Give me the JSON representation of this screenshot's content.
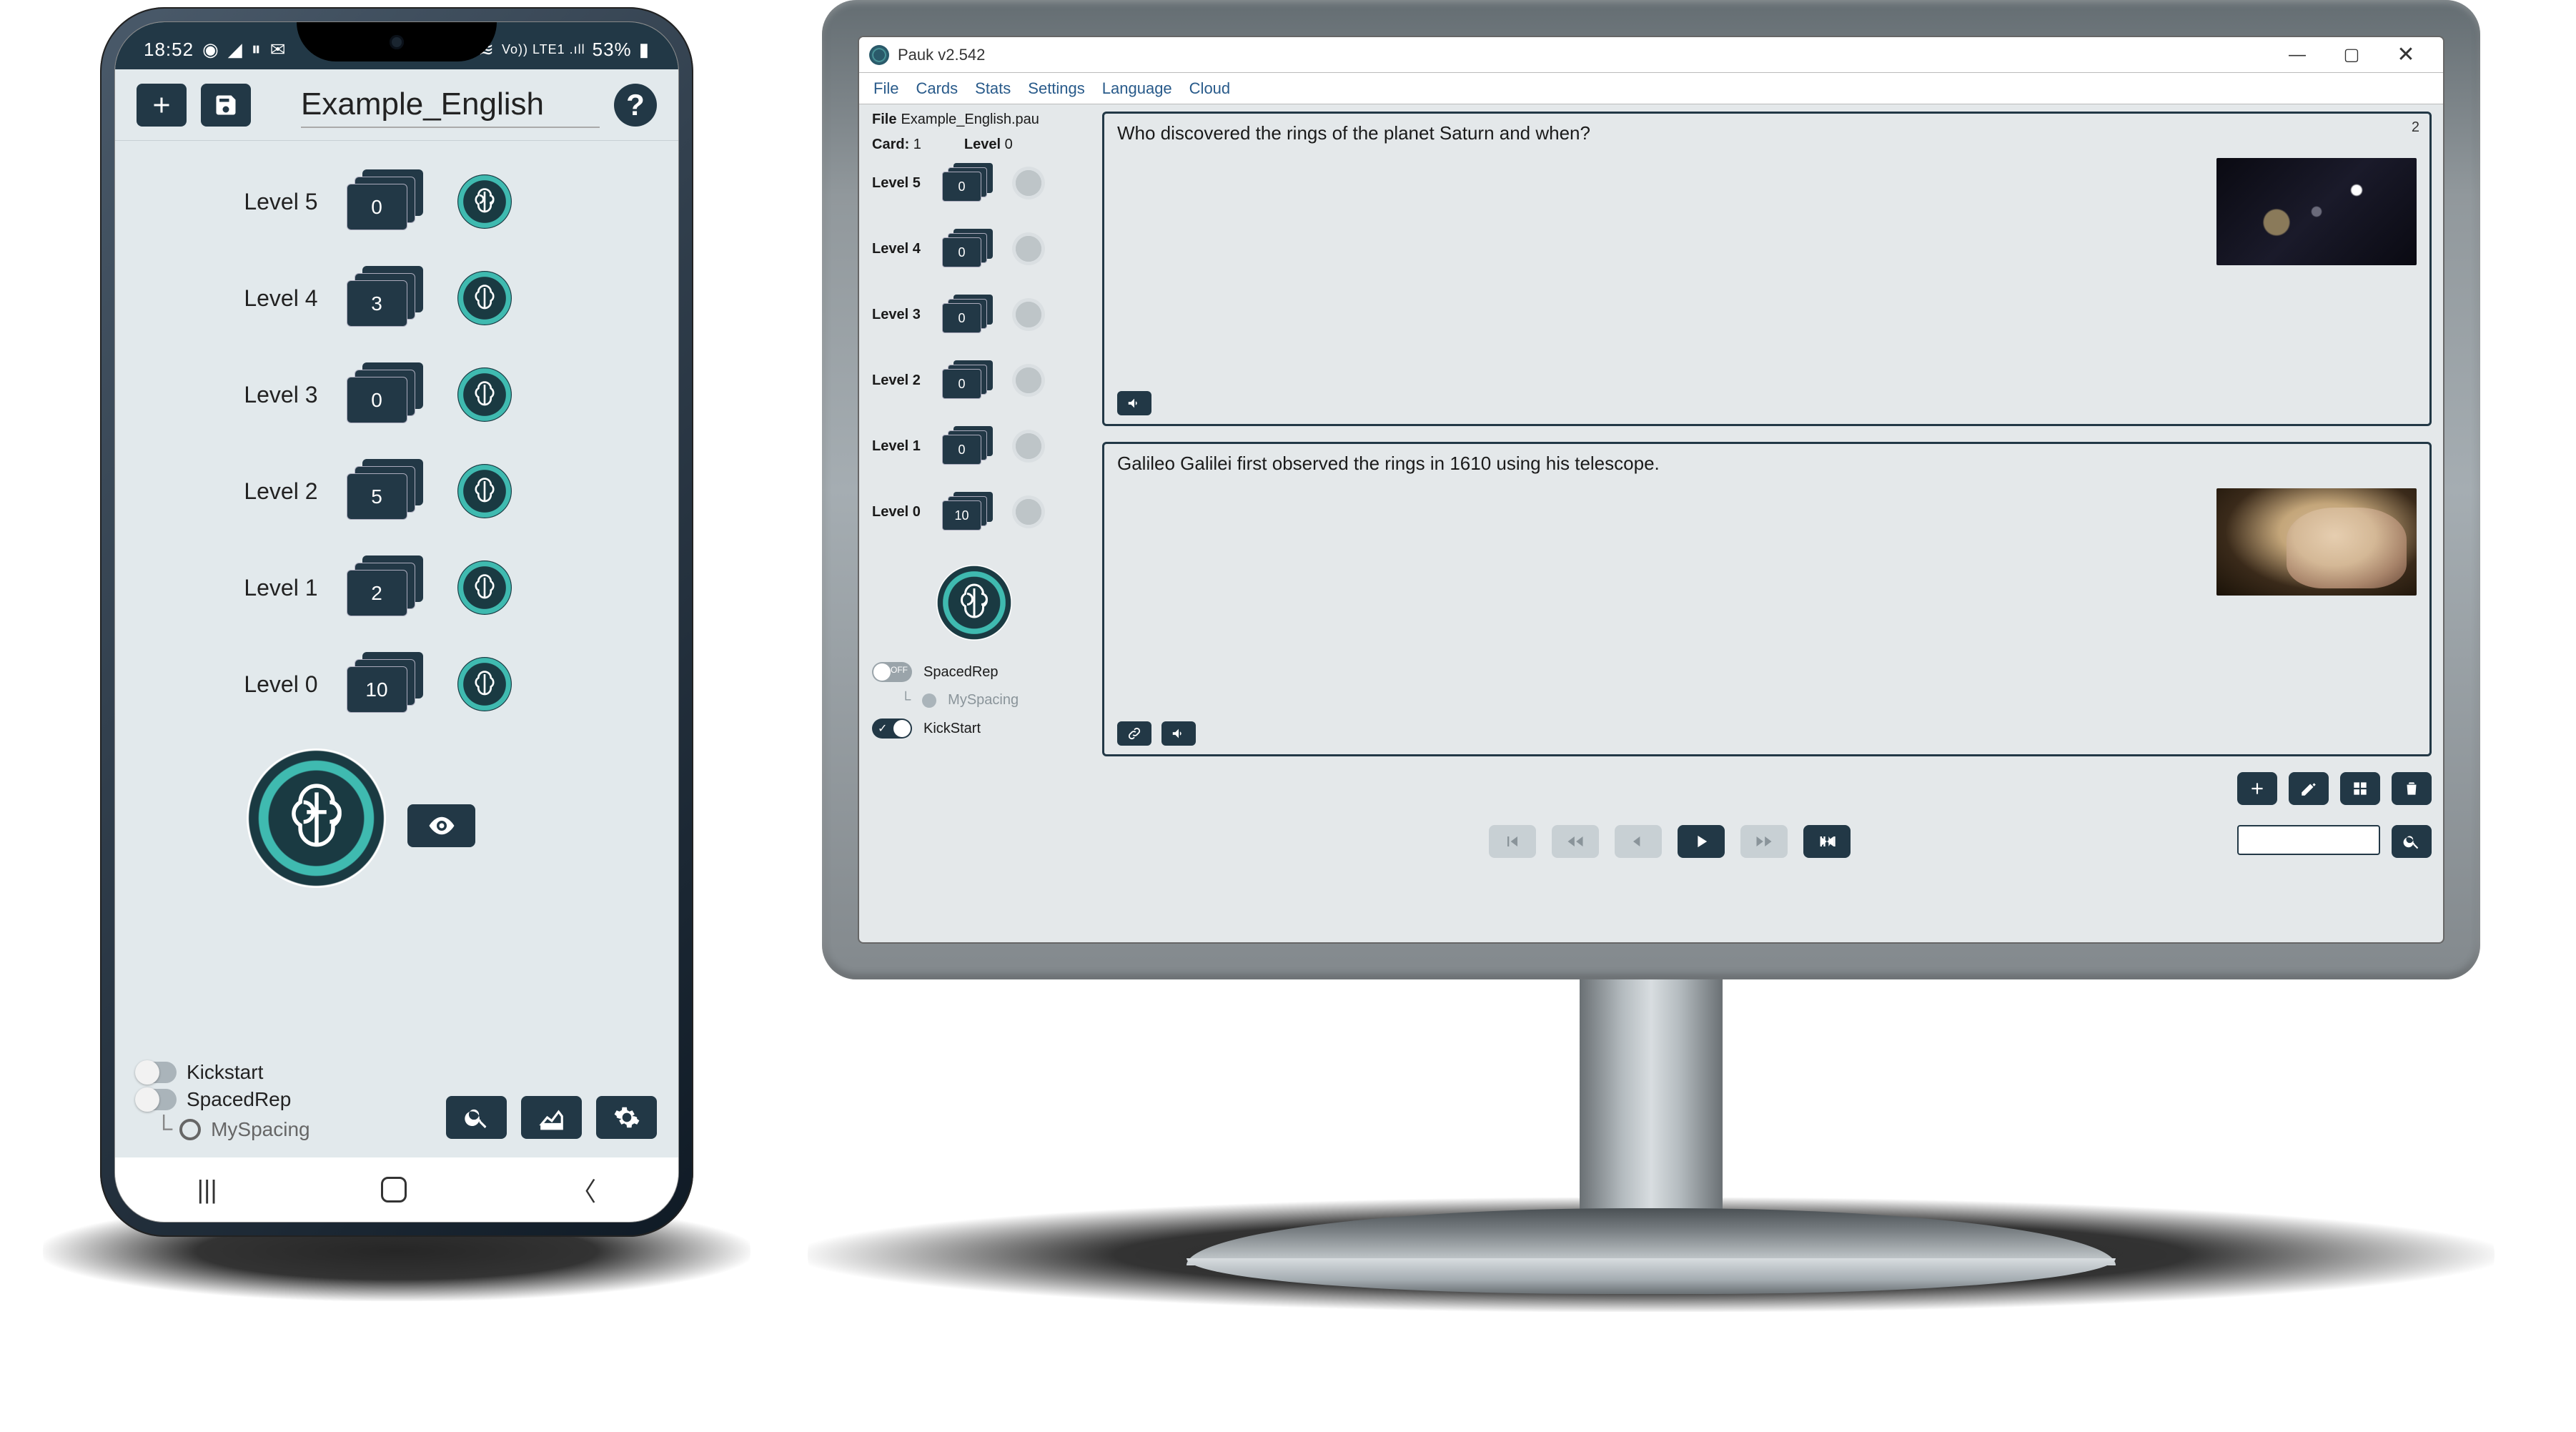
{
  "phone": {
    "status": {
      "time": "18:52",
      "battery": "53%",
      "signal": "Vo)) LTE1 .ıll"
    },
    "title": "Example_English",
    "levels": [
      {
        "label": "Level 5",
        "count": "0"
      },
      {
        "label": "Level 4",
        "count": "3"
      },
      {
        "label": "Level 3",
        "count": "0"
      },
      {
        "label": "Level 2",
        "count": "5"
      },
      {
        "label": "Level 1",
        "count": "2"
      },
      {
        "label": "Level 0",
        "count": "10"
      }
    ],
    "toggles": {
      "kickstart": "Kickstart",
      "spacedrep": "SpacedRep",
      "myspacing": "MySpacing"
    }
  },
  "desktop": {
    "window_title": "Pauk  v2.542",
    "menu": {
      "file": "File",
      "cards": "Cards",
      "stats": "Stats",
      "settings": "Settings",
      "language": "Language",
      "cloud": "Cloud"
    },
    "file_label": "File",
    "file_name": "Example_English.pau",
    "card_label": "Card:",
    "card_num": "1",
    "level_label": "Level",
    "level_num": "0",
    "levels": [
      {
        "label": "Level 5",
        "count": "0"
      },
      {
        "label": "Level 4",
        "count": "0"
      },
      {
        "label": "Level 3",
        "count": "0"
      },
      {
        "label": "Level 2",
        "count": "0"
      },
      {
        "label": "Level 1",
        "count": "0"
      },
      {
        "label": "Level 0",
        "count": "10"
      }
    ],
    "question": {
      "text": "Who discovered the rings of the planet Saturn and when?",
      "index": "2"
    },
    "answer": {
      "text": "Galileo Galilei first observed the rings in 1610 using his telescope."
    },
    "toggles": {
      "spacedrep": "SpacedRep",
      "myspacing": "MySpacing",
      "kickstart": "KickStart"
    }
  }
}
